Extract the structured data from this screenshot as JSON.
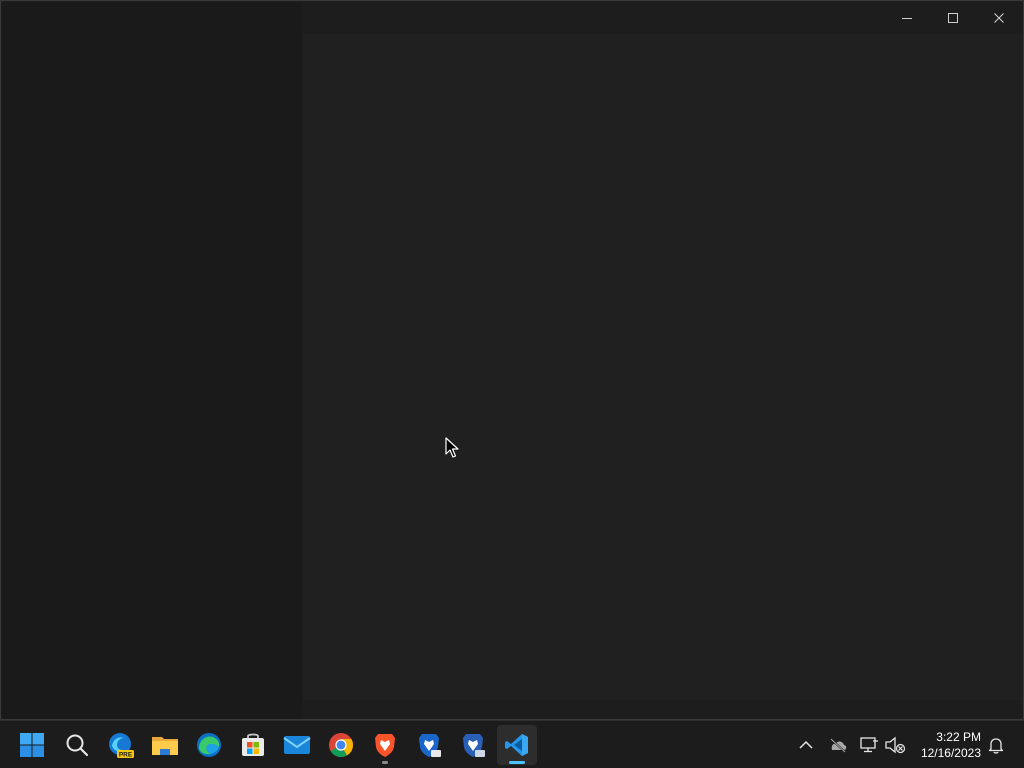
{
  "window": {
    "caption_buttons": [
      {
        "name": "minimize",
        "icon": "minimize-icon"
      },
      {
        "name": "maximize",
        "icon": "maximize-icon"
      },
      {
        "name": "close",
        "icon": "close-icon"
      }
    ]
  },
  "taskbar": {
    "apps": [
      {
        "name": "start",
        "icon": "windows-start-icon"
      },
      {
        "name": "search",
        "icon": "search-icon"
      },
      {
        "name": "edge-preview",
        "icon": "edge-preview-icon",
        "badge": "PRE"
      },
      {
        "name": "file-explorer",
        "icon": "folder-icon"
      },
      {
        "name": "edge",
        "icon": "edge-icon"
      },
      {
        "name": "microsoft-store",
        "icon": "store-icon"
      },
      {
        "name": "mail",
        "icon": "mail-icon"
      },
      {
        "name": "chrome",
        "icon": "chrome-icon"
      },
      {
        "name": "brave",
        "icon": "brave-icon",
        "running": true
      },
      {
        "name": "brave-beta",
        "icon": "brave-beta-icon"
      },
      {
        "name": "brave-nightly",
        "icon": "brave-nightly-icon"
      },
      {
        "name": "vscode",
        "icon": "vscode-icon",
        "active": true
      }
    ],
    "tray": {
      "icons": [
        "chevron-up-icon",
        "onedrive-offline-icon",
        "network-icon",
        "volume-muted-icon"
      ],
      "time": "3:22 PM",
      "date": "12/16/2023",
      "notification_icon": "bell-icon"
    }
  },
  "colors": {
    "accent": "#4cc2ff",
    "window_bg": "#1d1d1d",
    "content_bg": "#202020",
    "taskbar_bg": "#1c1c1c"
  }
}
